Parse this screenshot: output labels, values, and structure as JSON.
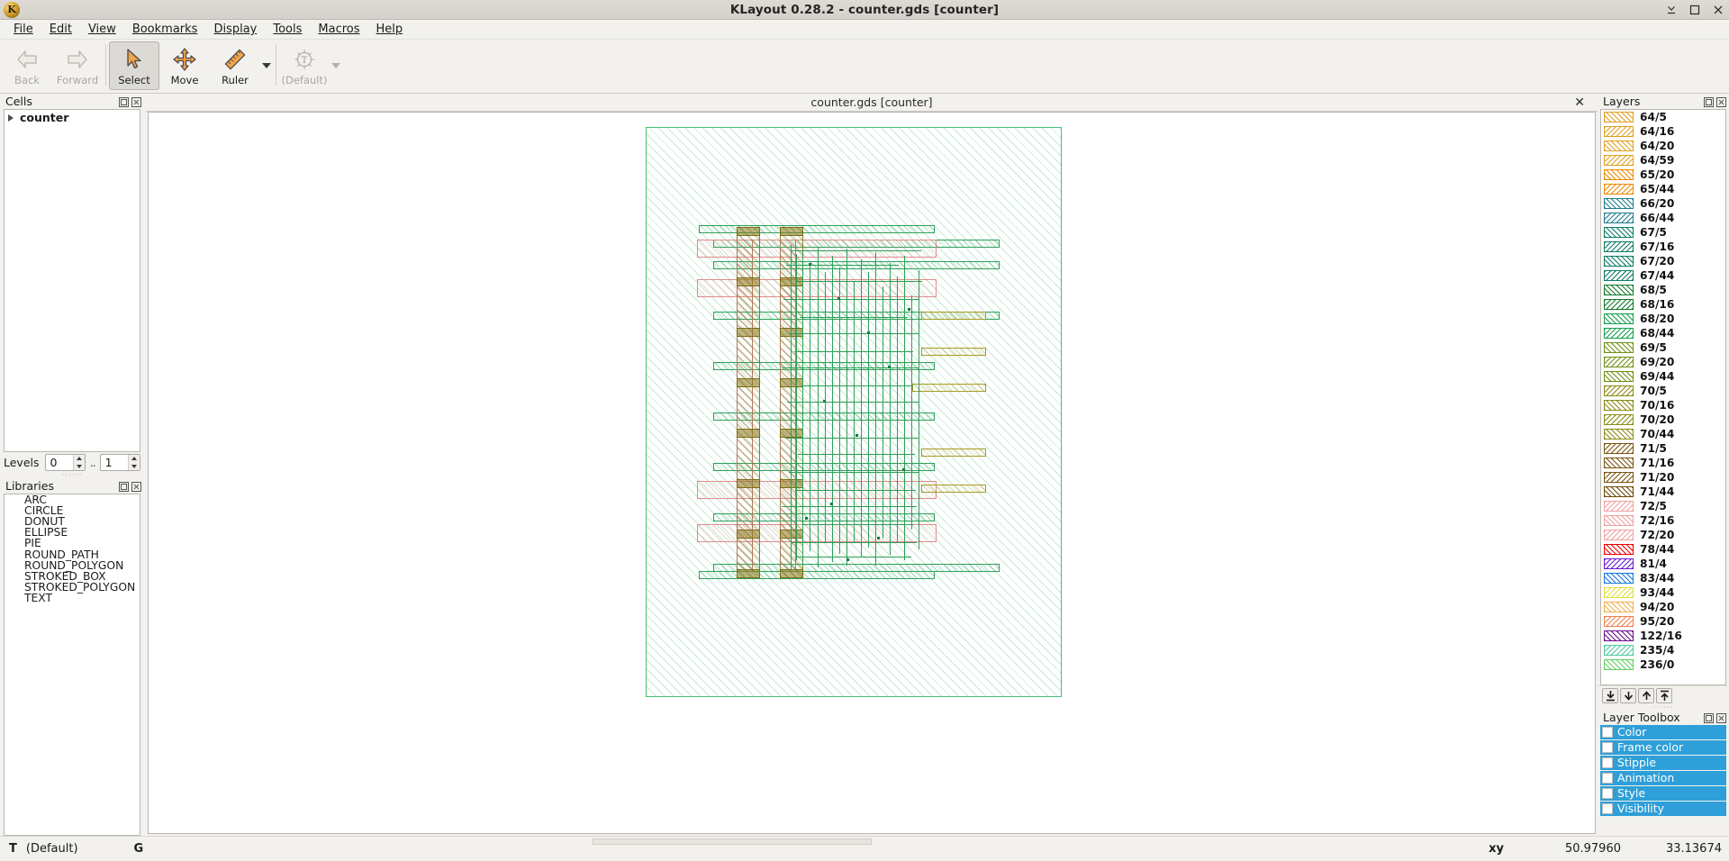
{
  "window": {
    "title": "KLayout 0.28.2 - counter.gds [counter]",
    "logo_letter": "K",
    "controls": [
      {
        "name": "minimize",
        "glyph": "minimize-icon"
      },
      {
        "name": "maximize",
        "glyph": "maximize-icon"
      },
      {
        "name": "close",
        "glyph": "close-icon"
      }
    ]
  },
  "menubar": {
    "items": [
      {
        "label": "File",
        "mnemonic": "F"
      },
      {
        "label": "Edit",
        "mnemonic": "E"
      },
      {
        "label": "View",
        "mnemonic": "V"
      },
      {
        "label": "Bookmarks",
        "mnemonic": "B"
      },
      {
        "label": "Display",
        "mnemonic": "D"
      },
      {
        "label": "Tools",
        "mnemonic": "T"
      },
      {
        "label": "Macros",
        "mnemonic": "M"
      },
      {
        "label": "Help",
        "mnemonic": "H"
      }
    ]
  },
  "toolbar": {
    "items": [
      {
        "label": "Back",
        "icon": "arrow-left-icon",
        "state": "disabled"
      },
      {
        "label": "Forward",
        "icon": "arrow-right-icon",
        "state": "disabled"
      },
      {
        "label": "Select",
        "icon": "cursor-arrow-icon",
        "state": "active"
      },
      {
        "label": "Move",
        "icon": "move-cross-icon",
        "state": "normal"
      },
      {
        "label": "Ruler",
        "icon": "ruler-icon",
        "state": "normal"
      },
      {
        "label": "(Default)",
        "icon": "text-tool-icon",
        "state": "disabled"
      }
    ]
  },
  "cells_panel": {
    "title": "Cells",
    "rows": [
      {
        "label": "counter",
        "expanded": false
      }
    ],
    "levels": {
      "label": "Levels",
      "from": "0",
      "separator": "..",
      "to": "1"
    }
  },
  "libraries_panel": {
    "title": "Libraries",
    "items": [
      "ARC",
      "CIRCLE",
      "DONUT",
      "ELLIPSE",
      "PIE",
      "ROUND_PATH",
      "ROUND_POLYGON",
      "STROKED_BOX",
      "STROKED_POLYGON",
      "TEXT"
    ]
  },
  "view": {
    "tab_label": "counter.gds [counter]",
    "close_glyph": "✕"
  },
  "layers_panel": {
    "title": "Layers",
    "items": [
      {
        "name": "64/5",
        "color": "#e0a020",
        "dir": "fwd"
      },
      {
        "name": "64/16",
        "color": "#e0a020",
        "dir": "back"
      },
      {
        "name": "64/20",
        "color": "#e0a020",
        "dir": "fwd"
      },
      {
        "name": "64/59",
        "color": "#e0a020",
        "dir": "back"
      },
      {
        "name": "65/20",
        "color": "#ee8800",
        "dir": "fwd"
      },
      {
        "name": "65/44",
        "color": "#ee8800",
        "dir": "back"
      },
      {
        "name": "66/20",
        "color": "#1f7c8c",
        "dir": "fwd"
      },
      {
        "name": "66/44",
        "color": "#1f7c8c",
        "dir": "back"
      },
      {
        "name": "67/5",
        "color": "#0d7a66",
        "dir": "fwd"
      },
      {
        "name": "67/16",
        "color": "#0d7a66",
        "dir": "back"
      },
      {
        "name": "67/20",
        "color": "#0d7a66",
        "dir": "fwd"
      },
      {
        "name": "67/44",
        "color": "#0d7a66",
        "dir": "back"
      },
      {
        "name": "68/5",
        "color": "#127a2a",
        "dir": "fwd"
      },
      {
        "name": "68/16",
        "color": "#127a2a",
        "dir": "back"
      },
      {
        "name": "68/20",
        "color": "#13a04a",
        "dir": "fwd"
      },
      {
        "name": "68/44",
        "color": "#13a04a",
        "dir": "back"
      },
      {
        "name": "69/5",
        "color": "#6f8f14",
        "dir": "fwd"
      },
      {
        "name": "69/20",
        "color": "#6f8f14",
        "dir": "back"
      },
      {
        "name": "69/44",
        "color": "#6f8f14",
        "dir": "fwd"
      },
      {
        "name": "70/5",
        "color": "#8a8a14",
        "dir": "back"
      },
      {
        "name": "70/16",
        "color": "#8a8a14",
        "dir": "fwd"
      },
      {
        "name": "70/20",
        "color": "#8a8a14",
        "dir": "back"
      },
      {
        "name": "70/44",
        "color": "#8a8a14",
        "dir": "fwd"
      },
      {
        "name": "71/5",
        "color": "#7a5410",
        "dir": "back"
      },
      {
        "name": "71/16",
        "color": "#7a5410",
        "dir": "fwd"
      },
      {
        "name": "71/20",
        "color": "#7a5410",
        "dir": "back"
      },
      {
        "name": "71/44",
        "color": "#6b4a08",
        "dir": "fwd"
      },
      {
        "name": "72/5",
        "color": "#f0a0a0",
        "dir": "back"
      },
      {
        "name": "72/16",
        "color": "#f0a0a0",
        "dir": "fwd"
      },
      {
        "name": "72/20",
        "color": "#f0a0a0",
        "dir": "back"
      },
      {
        "name": "78/44",
        "color": "#ee0000",
        "dir": "fwd"
      },
      {
        "name": "81/4",
        "color": "#6a1ad0",
        "dir": "back"
      },
      {
        "name": "83/44",
        "color": "#1478dc",
        "dir": "fwd"
      },
      {
        "name": "93/44",
        "color": "#e0e040",
        "dir": "back"
      },
      {
        "name": "94/20",
        "color": "#f0b050",
        "dir": "fwd"
      },
      {
        "name": "95/20",
        "color": "#f08050",
        "dir": "back"
      },
      {
        "name": "122/16",
        "color": "#6a0a8a",
        "dir": "fwd"
      },
      {
        "name": "235/4",
        "color": "#50c8a0",
        "dir": "back"
      },
      {
        "name": "236/0",
        "color": "#60d060",
        "dir": "fwd"
      }
    ],
    "buttons": [
      {
        "name": "move-to-bottom",
        "icon": "down-to-line-icon"
      },
      {
        "name": "move-down",
        "icon": "arrow-down-icon"
      },
      {
        "name": "move-up",
        "icon": "arrow-up-icon"
      },
      {
        "name": "move-to-top",
        "icon": "up-to-line-icon"
      }
    ]
  },
  "layer_toolbox": {
    "title": "Layer Toolbox",
    "items": [
      {
        "label": "Color",
        "checked": false
      },
      {
        "label": "Frame color",
        "checked": false
      },
      {
        "label": "Stipple",
        "checked": false
      },
      {
        "label": "Animation",
        "checked": false
      },
      {
        "label": "Style",
        "checked": false
      },
      {
        "label": "Visibility",
        "checked": false
      }
    ],
    "accent": "#2e9fd8"
  },
  "statusbar": {
    "tool_letter": "T",
    "tool_name": "(Default)",
    "grid_letter": "G",
    "xy_label": "xy",
    "x_value": "50.97960",
    "y_value": "33.13674"
  },
  "dock_buttons": {
    "float_glyph": "float-icon",
    "close_glyph": "close-icon"
  }
}
